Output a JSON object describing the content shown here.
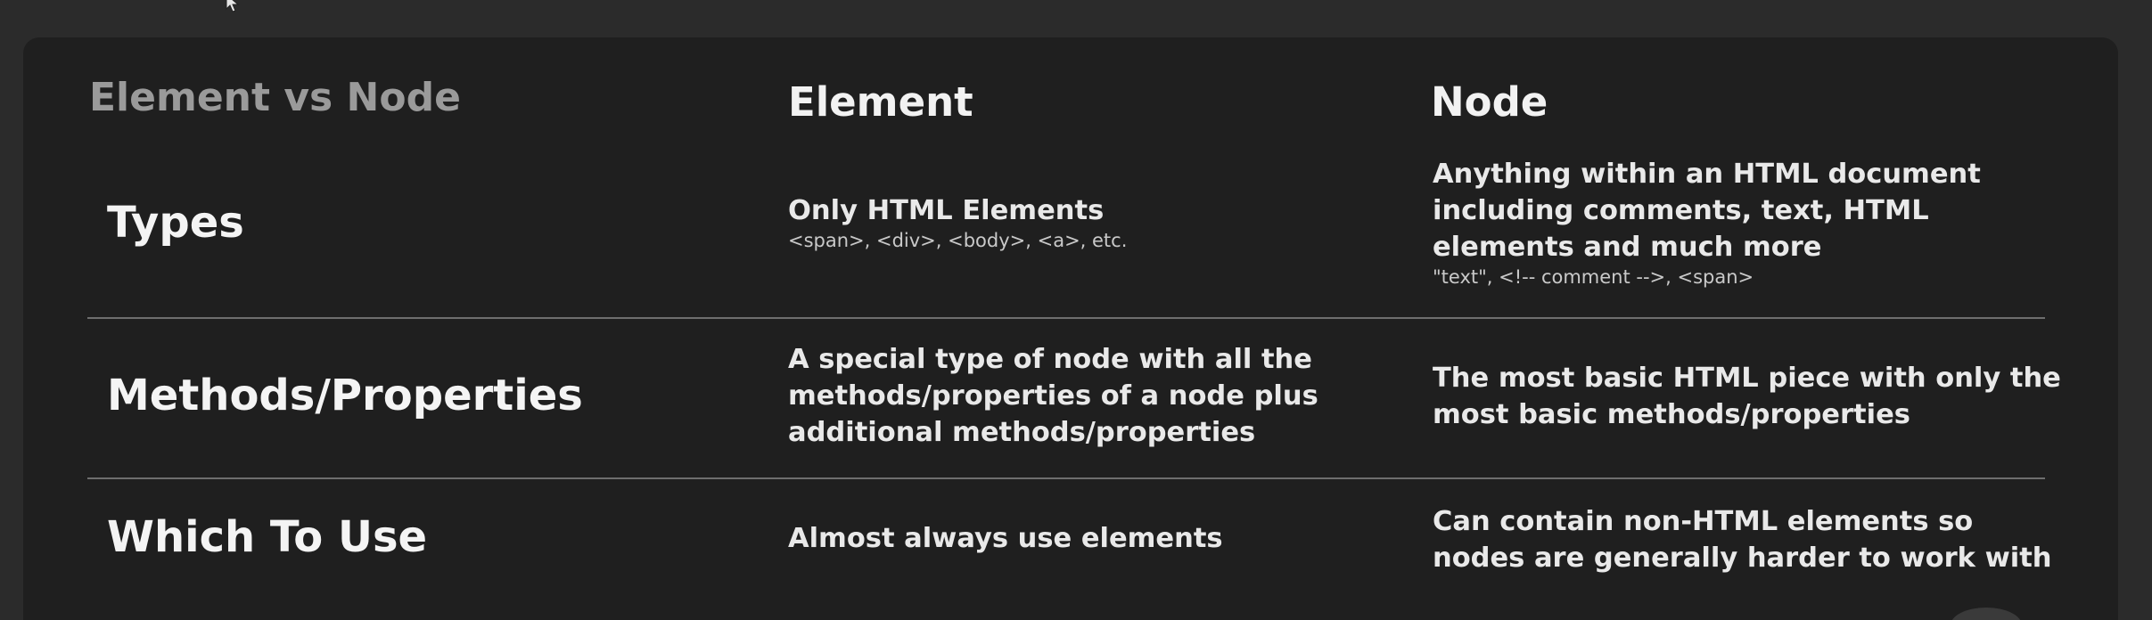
{
  "table": {
    "corner_title": "Element vs Node",
    "columns": {
      "element": "Element",
      "node": "Node"
    },
    "rows": [
      {
        "label": "Types",
        "element": {
          "lines": [
            "Only HTML Elements"
          ],
          "sub": "<span>, <div>, <body>, <a>, etc."
        },
        "node": {
          "lines": [
            "Anything within an HTML document",
            "including comments, text, HTML",
            "elements and much more"
          ],
          "sub": "\"text\", <!-- comment -->, <span>"
        }
      },
      {
        "label": "Methods/Properties",
        "element": {
          "lines": [
            "A special type of node with all the",
            "methods/properties of a node plus",
            "additional methods/properties"
          ]
        },
        "node": {
          "lines": [
            "The most basic HTML piece with only the",
            "most basic methods/properties"
          ]
        }
      },
      {
        "label": "Which To Use",
        "element": {
          "lines": [
            "Almost always use elements"
          ]
        },
        "node": {
          "lines": [
            "Can contain non-HTML elements so",
            "nodes are generally harder to work with"
          ]
        }
      }
    ]
  },
  "colors": {
    "background": "#2b2b2b",
    "card": "#1f1f1f",
    "text": "#e9e9e9",
    "muted_title": "#9a9a9a",
    "divider": "#6e6e6e"
  },
  "icons": {
    "cursor": "mouse-pointer-icon"
  }
}
